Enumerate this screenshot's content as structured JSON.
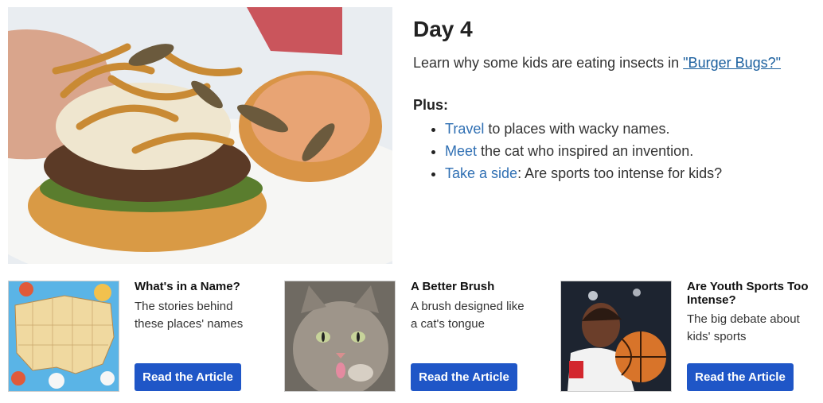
{
  "hero": {
    "day_title": "Day 4",
    "intro_text": "Learn why some kids are eating insects in ",
    "intro_link": "\"Burger Bugs?\"",
    "plus_label": "Plus:",
    "items": [
      {
        "link": "Travel",
        "text": " to places with wacky names."
      },
      {
        "link": "Meet",
        "text": " the cat who inspired an invention."
      },
      {
        "link": "Take a side",
        "text": ": Are sports too intense for kids?"
      }
    ]
  },
  "cards": [
    {
      "title": "What's in a Name?",
      "description": "The stories behind these places' names",
      "button": "Read the Article"
    },
    {
      "title": "A Better Brush",
      "description": "A brush designed like a cat's tongue",
      "button": "Read the Article"
    },
    {
      "title": "Are Youth Sports Too Intense?",
      "description": "The big debate about kids' sports",
      "button": "Read the Article"
    }
  ],
  "colors": {
    "button": "#1f56c7",
    "inline_link": "#2f6fb3",
    "article_link": "#1a5f9e"
  }
}
